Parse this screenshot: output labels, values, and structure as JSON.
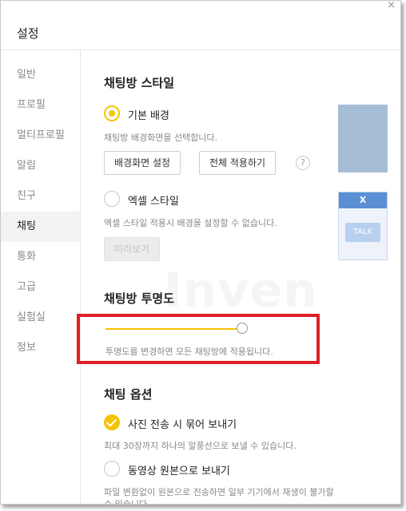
{
  "window": {
    "title": "설정",
    "close_glyph": "×"
  },
  "sidebar": {
    "items": [
      {
        "label": "일반"
      },
      {
        "label": "프로필"
      },
      {
        "label": "멀티프로필"
      },
      {
        "label": "알림"
      },
      {
        "label": "친구"
      },
      {
        "label": "채팅",
        "active": true
      },
      {
        "label": "통화"
      },
      {
        "label": "고급"
      },
      {
        "label": "실험실"
      },
      {
        "label": "정보"
      }
    ]
  },
  "chat_style": {
    "title": "채팅방 스타일",
    "basic": {
      "label": "기본 배경",
      "selected": true,
      "desc": "채팅방 배경화면을 선택합니다."
    },
    "set_bg_button": "배경화면 설정",
    "apply_all_button": "전체 적용하기",
    "help_glyph": "?",
    "excel": {
      "label": "엑셀 스타일",
      "selected": false,
      "desc": "엑셀 스타일 적용시 배경을 설정할 수 없습니다."
    },
    "preview_button": "미리보기",
    "excel_preview": {
      "top": "X",
      "talk": "TALK"
    }
  },
  "transparency": {
    "title": "채팅방 투명도",
    "value": 1.0,
    "desc": "투명도를 변경하면 모든 채팅방에 적용됩니다."
  },
  "chat_options": {
    "title": "채팅 옵션",
    "photo": {
      "label": "사진 전송 시 묶어 보내기",
      "checked": true,
      "desc": "최대 30장까지 하나의 말풍선으로 보낼 수 있습니다."
    },
    "video": {
      "label": "동영상 원본으로 보내기",
      "checked": false,
      "desc1": "파일 변환없이 원본으로 전송하면 일부 기기에서 재생이 불가할",
      "desc2": "수 있습니다."
    }
  },
  "watermark": "Inven",
  "colors": {
    "accent": "#f5c400",
    "highlight": "#e01f26"
  }
}
